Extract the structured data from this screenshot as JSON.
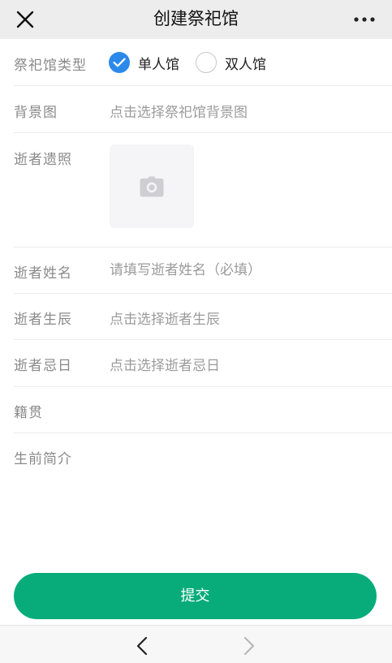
{
  "header": {
    "title": "创建祭祀馆",
    "close_icon": "close-icon",
    "more_icon": "more-dots-icon"
  },
  "form": {
    "hall_type": {
      "label": "祭祀馆类型",
      "options": [
        {
          "label": "单人馆",
          "selected": true
        },
        {
          "label": "双人馆",
          "selected": false
        }
      ]
    },
    "background": {
      "label": "背景图",
      "placeholder": "点击选择祭祀馆背景图"
    },
    "portrait": {
      "label": "逝者遗照",
      "icon": "camera-icon"
    },
    "name": {
      "label": "逝者姓名",
      "placeholder": "请填写逝者姓名（必填）"
    },
    "birth": {
      "label": "逝者生辰",
      "placeholder": "点击选择逝者生辰"
    },
    "death": {
      "label": "逝者忌日",
      "placeholder": "点击选择逝者忌日"
    },
    "hometown": {
      "label": "籍贯",
      "value": ""
    },
    "intro": {
      "label": "生前简介",
      "value": ""
    }
  },
  "submit": {
    "label": "提交"
  },
  "colors": {
    "accent_green": "#07ac7a",
    "radio_blue": "#2b89ea",
    "topbar_bg": "#ededed"
  },
  "footer": {
    "back_icon": "chevron-left-icon",
    "forward_icon": "chevron-right-icon"
  }
}
